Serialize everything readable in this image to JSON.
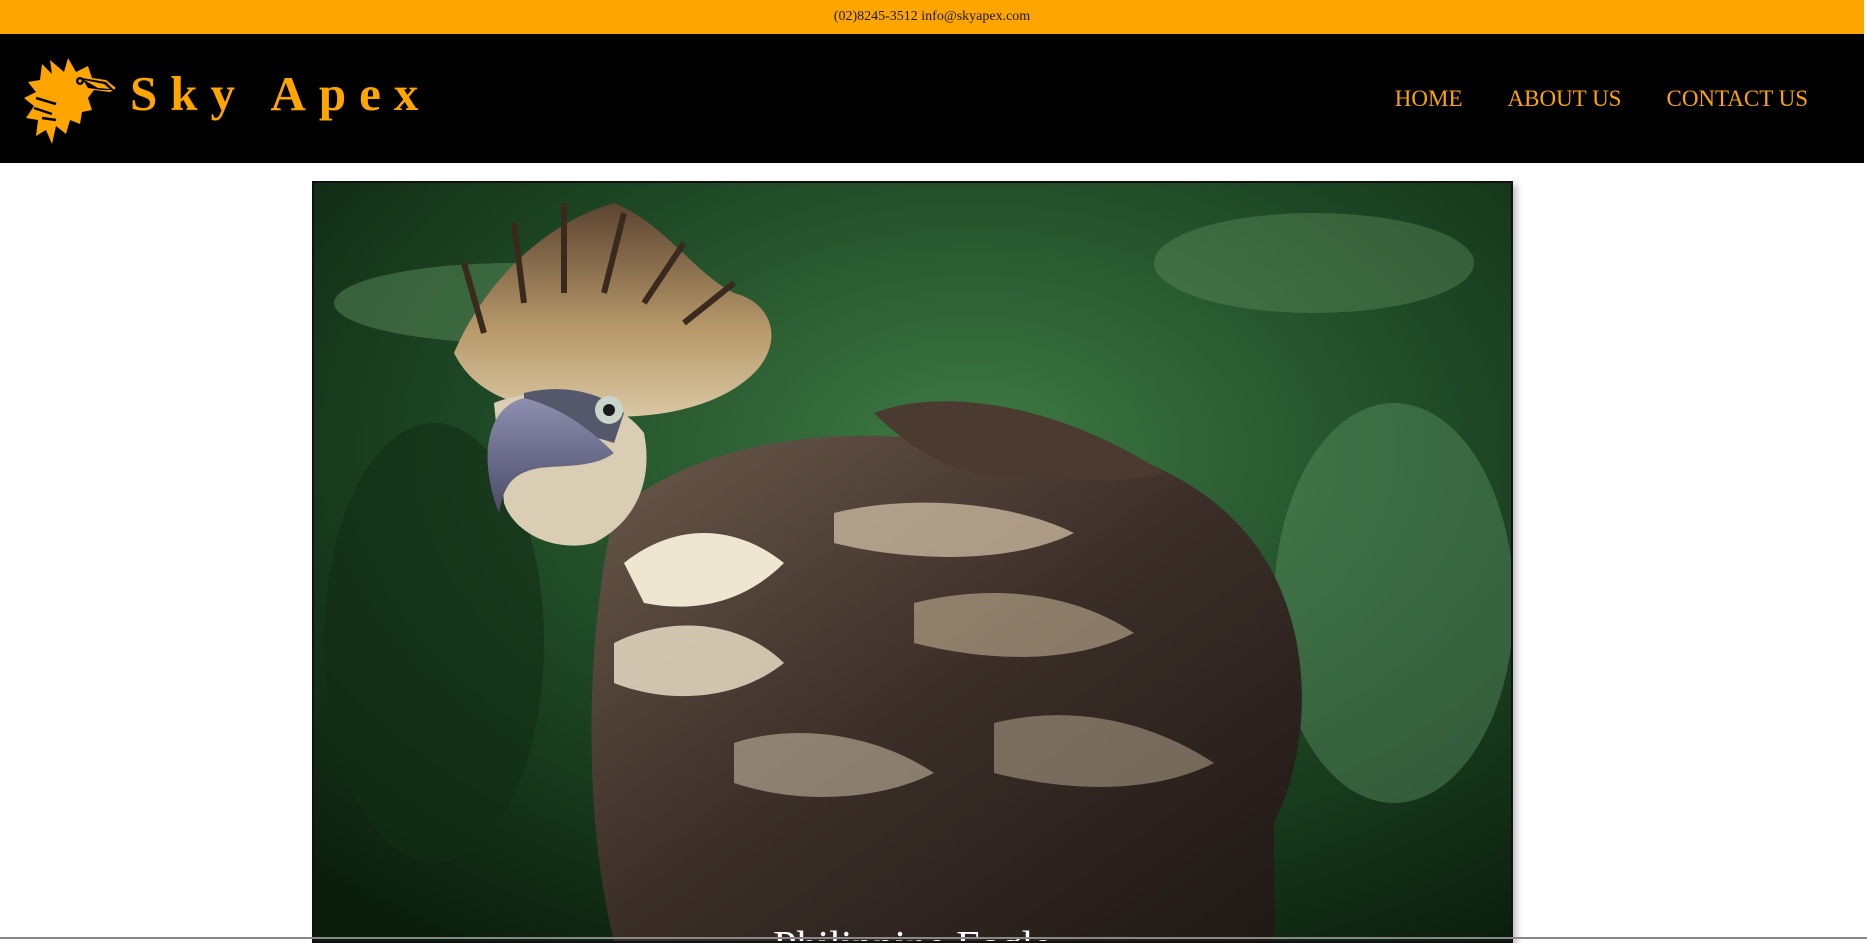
{
  "topbar": {
    "contact": "(02)8245-3512 info@skyapex.com"
  },
  "header": {
    "logo_icon": "eagle-head-logo",
    "brand": "Sky Apex"
  },
  "nav": {
    "items": [
      {
        "label": "HOME"
      },
      {
        "label": "ABOUT US"
      },
      {
        "label": "CONTACT US"
      }
    ]
  },
  "hero": {
    "image": "philippine-eagle-photo",
    "caption": "Philippine Eagle"
  },
  "colors": {
    "accent": "#FFA500",
    "header_bg": "#000000",
    "page_bg": "#FFFFFF"
  }
}
